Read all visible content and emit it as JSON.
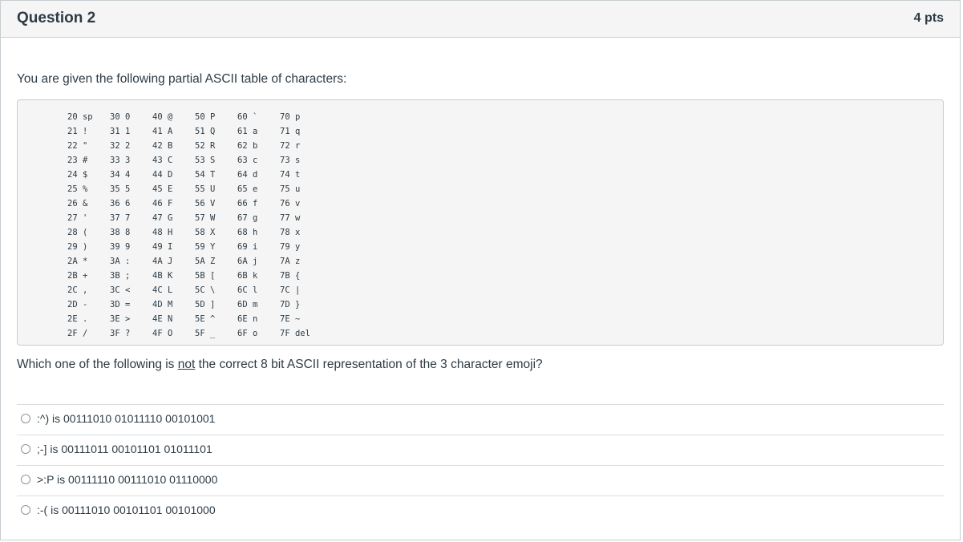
{
  "question": {
    "title": "Question 2",
    "points": "4 pts",
    "prompt": "You are given the following partial ASCII table of characters:",
    "text_before": "Which one of the following is ",
    "text_emphasis": "not",
    "text_after": " the correct 8 bit ASCII representation of the 3 character emoji?"
  },
  "ascii_table": {
    "rows": [
      [
        "20 sp",
        "30 0",
        "40 @",
        "50 P",
        "60 `",
        "70 p"
      ],
      [
        "21 !",
        "31 1",
        "41 A",
        "51 Q",
        "61 a",
        "71 q"
      ],
      [
        "22 \"",
        "32 2",
        "42 B",
        "52 R",
        "62 b",
        "72 r"
      ],
      [
        "23 #",
        "33 3",
        "43 C",
        "53 S",
        "63 c",
        "73 s"
      ],
      [
        "24 $",
        "34 4",
        "44 D",
        "54 T",
        "64 d",
        "74 t"
      ],
      [
        "25 %",
        "35 5",
        "45 E",
        "55 U",
        "65 e",
        "75 u"
      ],
      [
        "26 &",
        "36 6",
        "46 F",
        "56 V",
        "66 f",
        "76 v"
      ],
      [
        "27 '",
        "37 7",
        "47 G",
        "57 W",
        "67 g",
        "77 w"
      ],
      [
        "28 (",
        "38 8",
        "48 H",
        "58 X",
        "68 h",
        "78 x"
      ],
      [
        "29 )",
        "39 9",
        "49 I",
        "59 Y",
        "69 i",
        "79 y"
      ],
      [
        "2A *",
        "3A :",
        "4A J",
        "5A Z",
        "6A j",
        "7A z"
      ],
      [
        "2B +",
        "3B ;",
        "4B K",
        "5B [",
        "6B k",
        "7B {"
      ],
      [
        "2C ,",
        "3C <",
        "4C L",
        "5C \\",
        "6C l",
        "7C |"
      ],
      [
        "2D -",
        "3D =",
        "4D M",
        "5D ]",
        "6D m",
        "7D }"
      ],
      [
        "2E .",
        "3E >",
        "4E N",
        "5E ^",
        "6E n",
        "7E ~"
      ],
      [
        "2F /",
        "3F ?",
        "4F O",
        "5F _",
        "6F o",
        "7F del"
      ]
    ]
  },
  "answers": [
    {
      "label": ":^) is 00111010 01011110 00101001"
    },
    {
      "label": ";-] is 00111011 00101101 01011101"
    },
    {
      "label": ">:P is 00111110 00111010 01110000"
    },
    {
      "label": ":-( is 00111010 00101101 00101000"
    }
  ]
}
